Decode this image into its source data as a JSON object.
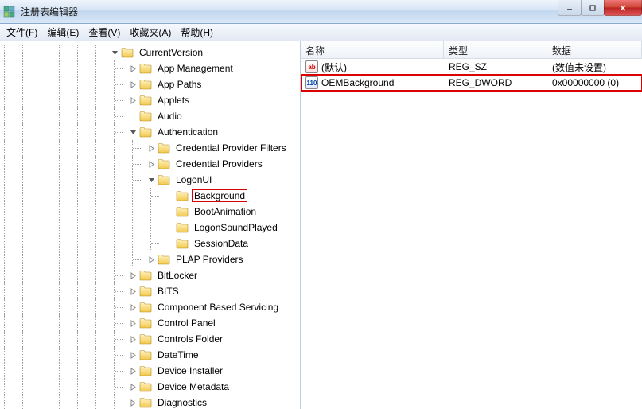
{
  "window": {
    "title": "注册表编辑器"
  },
  "menu": {
    "file": "文件(F)",
    "edit": "编辑(E)",
    "view": "查看(V)",
    "favorites": "收藏夹(A)",
    "help": "帮助(H)"
  },
  "tree": {
    "items": [
      {
        "depth": 6,
        "exp": "open",
        "label": "CurrentVersion"
      },
      {
        "depth": 7,
        "exp": "closed",
        "label": "App Management"
      },
      {
        "depth": 7,
        "exp": "closed",
        "label": "App Paths"
      },
      {
        "depth": 7,
        "exp": "closed",
        "label": "Applets"
      },
      {
        "depth": 7,
        "exp": "none",
        "label": "Audio"
      },
      {
        "depth": 7,
        "exp": "open",
        "label": "Authentication"
      },
      {
        "depth": 8,
        "exp": "closed",
        "label": "Credential Provider Filters"
      },
      {
        "depth": 8,
        "exp": "closed",
        "label": "Credential Providers"
      },
      {
        "depth": 8,
        "exp": "open",
        "label": "LogonUI"
      },
      {
        "depth": 9,
        "exp": "none",
        "label": "Background",
        "selected": true
      },
      {
        "depth": 9,
        "exp": "none",
        "label": "BootAnimation"
      },
      {
        "depth": 9,
        "exp": "none",
        "label": "LogonSoundPlayed"
      },
      {
        "depth": 9,
        "exp": "none",
        "label": "SessionData"
      },
      {
        "depth": 8,
        "exp": "closed",
        "label": "PLAP Providers"
      },
      {
        "depth": 7,
        "exp": "closed",
        "label": "BitLocker"
      },
      {
        "depth": 7,
        "exp": "closed",
        "label": "BITS"
      },
      {
        "depth": 7,
        "exp": "closed",
        "label": "Component Based Servicing"
      },
      {
        "depth": 7,
        "exp": "closed",
        "label": "Control Panel"
      },
      {
        "depth": 7,
        "exp": "closed",
        "label": "Controls Folder"
      },
      {
        "depth": 7,
        "exp": "closed",
        "label": "DateTime"
      },
      {
        "depth": 7,
        "exp": "closed",
        "label": "Device Installer"
      },
      {
        "depth": 7,
        "exp": "closed",
        "label": "Device Metadata"
      },
      {
        "depth": 7,
        "exp": "closed",
        "label": "Diagnostics"
      }
    ]
  },
  "list": {
    "cols": {
      "name": "名称",
      "type": "类型",
      "data": "数据"
    },
    "rows": [
      {
        "icon": "sz",
        "name": "(默认)",
        "type": "REG_SZ",
        "data": "(数值未设置)",
        "highlight": false
      },
      {
        "icon": "dword",
        "name": "OEMBackground",
        "type": "REG_DWORD",
        "data": "0x00000000 (0)",
        "highlight": true
      }
    ]
  }
}
